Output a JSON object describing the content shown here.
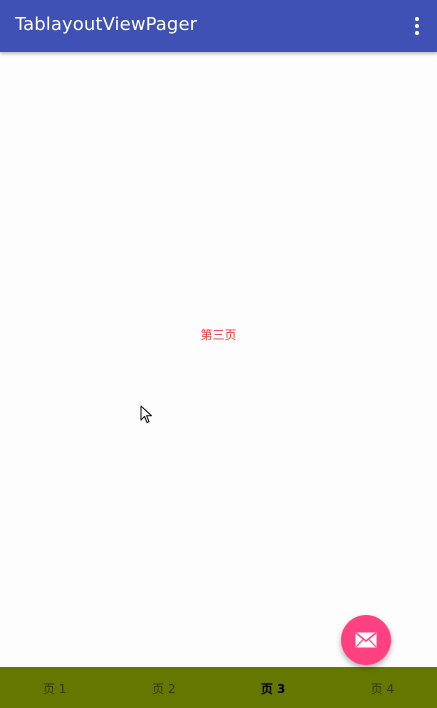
{
  "app_bar": {
    "title": "TablayoutViewPager",
    "menu_icon": "more-vert-icon",
    "background": "#3f51b5"
  },
  "content": {
    "page_label": "第三页",
    "label_color": "#e53935"
  },
  "fab": {
    "icon": "email-icon",
    "background": "#ff4081"
  },
  "tabs": {
    "background": "#667700",
    "selected_index": 2,
    "items": [
      {
        "label": "页 1"
      },
      {
        "label": "页 2"
      },
      {
        "label": "页 3"
      },
      {
        "label": "页 4"
      }
    ]
  }
}
